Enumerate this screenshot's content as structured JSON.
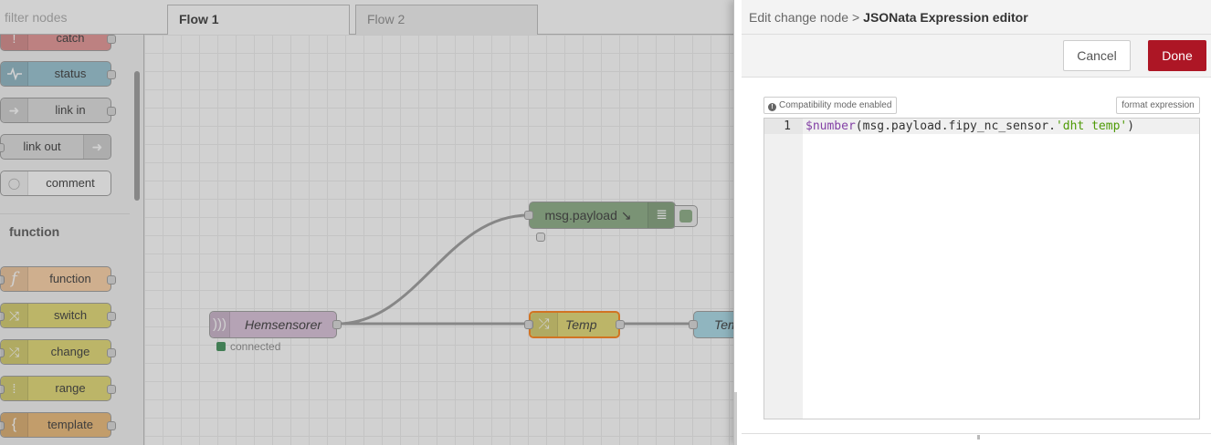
{
  "palette": {
    "filter_placeholder": "filter nodes",
    "nodes_top": [
      {
        "label": "catch",
        "color": "#e49191"
      },
      {
        "label": "status",
        "color": "#94c1d0"
      },
      {
        "label": "link in",
        "color": "#dddddd"
      },
      {
        "label": "link out",
        "color": "#dddddd"
      },
      {
        "label": "comment",
        "color": "#ffffff"
      }
    ],
    "category_function": "function",
    "nodes_function": [
      {
        "label": "function",
        "color": "#fdd0a2"
      },
      {
        "label": "switch",
        "color": "#e2d96e"
      },
      {
        "label": "change",
        "color": "#e2d96e"
      },
      {
        "label": "range",
        "color": "#e2d96e"
      },
      {
        "label": "template",
        "color": "#ebb772"
      }
    ]
  },
  "tabs": [
    {
      "label": "Flow 1",
      "active": true
    },
    {
      "label": "Flow 2",
      "active": false
    }
  ],
  "flow": {
    "debug_node": {
      "label": "msg.payload ↘",
      "color": "#87a980"
    },
    "input_node": {
      "label": "Hemsensorer",
      "color": "#d8bfd8",
      "status": "connected",
      "status_color": "#3a8c54"
    },
    "change_node": {
      "label": "Temp",
      "color": "#e2d96e",
      "highlight": "#ff7f0e"
    },
    "output_node": {
      "label": "Tem",
      "color": "#a6d9e6"
    }
  },
  "tray": {
    "breadcrumb_parent": "Edit change node",
    "breadcrumb_sep": ">",
    "breadcrumb_current": "JSONata Expression editor",
    "cancel_label": "Cancel",
    "done_label": "Done",
    "done_color": "#ad1625",
    "compat_label": "Compatibility mode enabled",
    "format_label": "format expression",
    "editor": {
      "line_number": "1",
      "code_fn": "$number",
      "code_mid": "(msg.payload.fipy_nc_sensor.",
      "code_str": "'dht temp'",
      "code_end": ")"
    }
  }
}
